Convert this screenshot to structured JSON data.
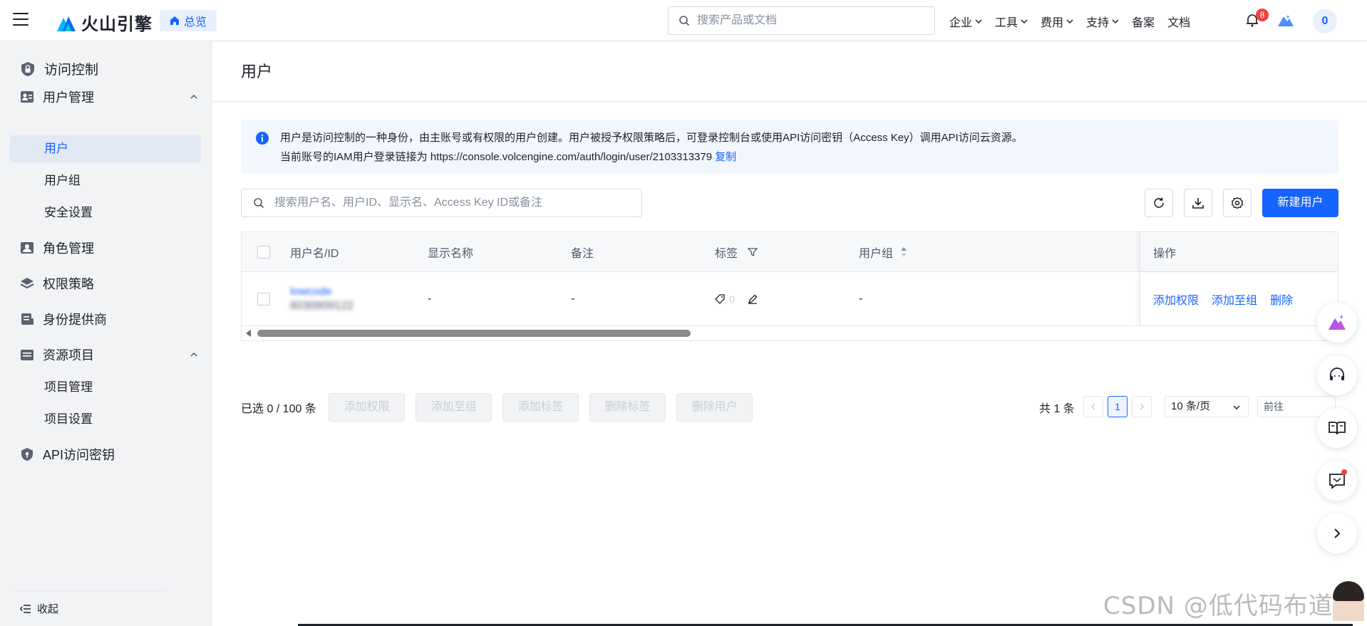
{
  "topbar": {
    "brand": "火山引擎",
    "overview_label": "总览",
    "search_placeholder": "搜索产品或文档",
    "nav": [
      "企业",
      "工具",
      "费用",
      "支持",
      "备案",
      "文档"
    ],
    "notifications": "8",
    "avatar_initial": "0"
  },
  "sidebar": {
    "title": "访问控制",
    "groups": {
      "user_mgmt": "用户管理",
      "role_mgmt": "角色管理",
      "policy": "权限策略",
      "idp": "身份提供商",
      "resource": "资源项目",
      "api_keys": "API访问密钥"
    },
    "subs": {
      "users": "用户",
      "user_groups": "用户组",
      "security": "安全设置",
      "project_mgmt": "项目管理",
      "project_settings": "项目设置"
    },
    "collapse_label": "收起"
  },
  "page": {
    "title": "用户",
    "info_line1": "用户是访问控制的一种身份，由主账号或有权限的用户创建。用户被授予权限策略后，可登录控制台或使用API访问密钥（Access Key）调用API访问云资源。",
    "info_line2": "当前账号的IAM用户登录链接为 https://console.volcengine.com/auth/login/user/2103313379",
    "copy_label": "复制",
    "search_placeholder": "搜索用户名、用户ID、显示名、Access Key ID或备注",
    "create_button": "新建用户"
  },
  "table": {
    "headers": {
      "name": "用户名/ID",
      "display_name": "显示名称",
      "remark": "备注",
      "tags": "标签",
      "group": "用户组",
      "ops": "操作"
    },
    "rows": [
      {
        "name_blurred": "lowcode",
        "id_blurred": "6030909122",
        "display_name": "-",
        "remark": "-",
        "tag_count": "0",
        "group": "-",
        "ops": [
          "添加权限",
          "添加至组",
          "删除"
        ]
      }
    ]
  },
  "footer": {
    "selected": "已选 0 / 100 条",
    "bulk_actions": [
      "添加权限",
      "添加至组",
      "添加标签",
      "删除标签",
      "删除用户"
    ],
    "total": "共 1 条",
    "current_page": "1",
    "page_size": "10 条/页",
    "goto_label": "前往"
  },
  "watermark": "CSDN @低代码布道师",
  "colors": {
    "primary": "#1664ff",
    "danger": "#f53f3f",
    "sidebar_bg": "#f2f3f5"
  }
}
